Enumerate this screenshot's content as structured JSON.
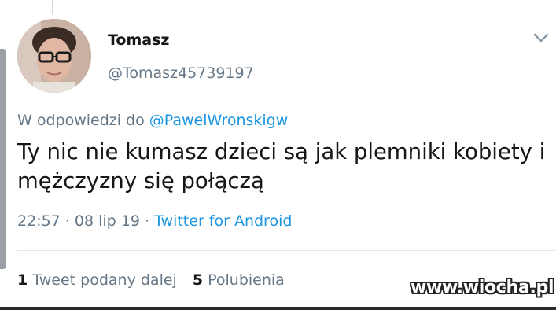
{
  "tweet": {
    "author_name": "Tomasz",
    "author_handle": "@Tomasz45739197",
    "reply_prefix": "W odpowiedzi do ",
    "reply_to": "@PawelWronskigw",
    "text": "Ty nic nie kumasz dzieci są jak plemniki kobiety i mężczyzny się połączą",
    "time": "22:57",
    "separator": " · ",
    "date": "08 lip 19",
    "client": "Twitter for Android",
    "retweet_count": "1",
    "retweet_label": "Tweet podany dalej",
    "like_count": "5",
    "like_label": "Polubienia"
  },
  "icons": {
    "menu": "chevron-down-icon",
    "avatar": "profile-photo"
  },
  "watermark": "www.wiocha.pl",
  "colors": {
    "link": "#1b95e0",
    "secondary": "#657786",
    "text": "#14171a"
  }
}
